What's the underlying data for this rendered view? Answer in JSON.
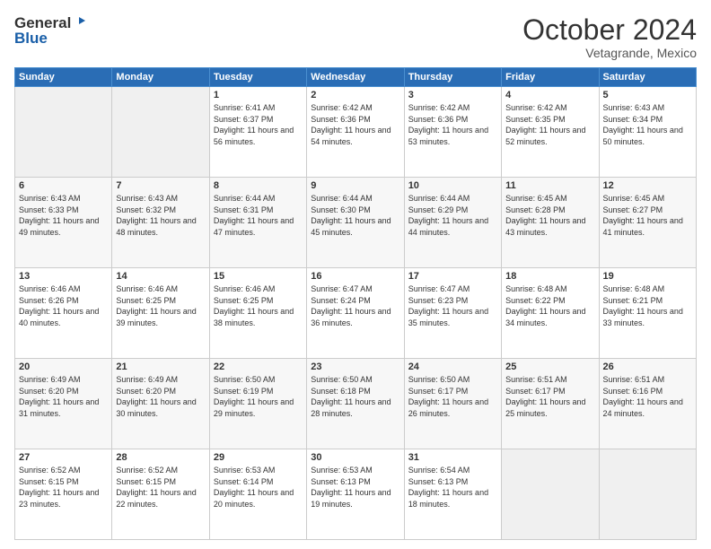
{
  "header": {
    "logo_general": "General",
    "logo_blue": "Blue",
    "month": "October 2024",
    "location": "Vetagrande, Mexico"
  },
  "days_of_week": [
    "Sunday",
    "Monday",
    "Tuesday",
    "Wednesday",
    "Thursday",
    "Friday",
    "Saturday"
  ],
  "weeks": [
    [
      {
        "day": "",
        "sunrise": "",
        "sunset": "",
        "daylight": "",
        "empty": true
      },
      {
        "day": "",
        "sunrise": "",
        "sunset": "",
        "daylight": "",
        "empty": true
      },
      {
        "day": "1",
        "sunrise": "Sunrise: 6:41 AM",
        "sunset": "Sunset: 6:37 PM",
        "daylight": "Daylight: 11 hours and 56 minutes."
      },
      {
        "day": "2",
        "sunrise": "Sunrise: 6:42 AM",
        "sunset": "Sunset: 6:36 PM",
        "daylight": "Daylight: 11 hours and 54 minutes."
      },
      {
        "day": "3",
        "sunrise": "Sunrise: 6:42 AM",
        "sunset": "Sunset: 6:36 PM",
        "daylight": "Daylight: 11 hours and 53 minutes."
      },
      {
        "day": "4",
        "sunrise": "Sunrise: 6:42 AM",
        "sunset": "Sunset: 6:35 PM",
        "daylight": "Daylight: 11 hours and 52 minutes."
      },
      {
        "day": "5",
        "sunrise": "Sunrise: 6:43 AM",
        "sunset": "Sunset: 6:34 PM",
        "daylight": "Daylight: 11 hours and 50 minutes."
      }
    ],
    [
      {
        "day": "6",
        "sunrise": "Sunrise: 6:43 AM",
        "sunset": "Sunset: 6:33 PM",
        "daylight": "Daylight: 11 hours and 49 minutes."
      },
      {
        "day": "7",
        "sunrise": "Sunrise: 6:43 AM",
        "sunset": "Sunset: 6:32 PM",
        "daylight": "Daylight: 11 hours and 48 minutes."
      },
      {
        "day": "8",
        "sunrise": "Sunrise: 6:44 AM",
        "sunset": "Sunset: 6:31 PM",
        "daylight": "Daylight: 11 hours and 47 minutes."
      },
      {
        "day": "9",
        "sunrise": "Sunrise: 6:44 AM",
        "sunset": "Sunset: 6:30 PM",
        "daylight": "Daylight: 11 hours and 45 minutes."
      },
      {
        "day": "10",
        "sunrise": "Sunrise: 6:44 AM",
        "sunset": "Sunset: 6:29 PM",
        "daylight": "Daylight: 11 hours and 44 minutes."
      },
      {
        "day": "11",
        "sunrise": "Sunrise: 6:45 AM",
        "sunset": "Sunset: 6:28 PM",
        "daylight": "Daylight: 11 hours and 43 minutes."
      },
      {
        "day": "12",
        "sunrise": "Sunrise: 6:45 AM",
        "sunset": "Sunset: 6:27 PM",
        "daylight": "Daylight: 11 hours and 41 minutes."
      }
    ],
    [
      {
        "day": "13",
        "sunrise": "Sunrise: 6:46 AM",
        "sunset": "Sunset: 6:26 PM",
        "daylight": "Daylight: 11 hours and 40 minutes."
      },
      {
        "day": "14",
        "sunrise": "Sunrise: 6:46 AM",
        "sunset": "Sunset: 6:25 PM",
        "daylight": "Daylight: 11 hours and 39 minutes."
      },
      {
        "day": "15",
        "sunrise": "Sunrise: 6:46 AM",
        "sunset": "Sunset: 6:25 PM",
        "daylight": "Daylight: 11 hours and 38 minutes."
      },
      {
        "day": "16",
        "sunrise": "Sunrise: 6:47 AM",
        "sunset": "Sunset: 6:24 PM",
        "daylight": "Daylight: 11 hours and 36 minutes."
      },
      {
        "day": "17",
        "sunrise": "Sunrise: 6:47 AM",
        "sunset": "Sunset: 6:23 PM",
        "daylight": "Daylight: 11 hours and 35 minutes."
      },
      {
        "day": "18",
        "sunrise": "Sunrise: 6:48 AM",
        "sunset": "Sunset: 6:22 PM",
        "daylight": "Daylight: 11 hours and 34 minutes."
      },
      {
        "day": "19",
        "sunrise": "Sunrise: 6:48 AM",
        "sunset": "Sunset: 6:21 PM",
        "daylight": "Daylight: 11 hours and 33 minutes."
      }
    ],
    [
      {
        "day": "20",
        "sunrise": "Sunrise: 6:49 AM",
        "sunset": "Sunset: 6:20 PM",
        "daylight": "Daylight: 11 hours and 31 minutes."
      },
      {
        "day": "21",
        "sunrise": "Sunrise: 6:49 AM",
        "sunset": "Sunset: 6:20 PM",
        "daylight": "Daylight: 11 hours and 30 minutes."
      },
      {
        "day": "22",
        "sunrise": "Sunrise: 6:50 AM",
        "sunset": "Sunset: 6:19 PM",
        "daylight": "Daylight: 11 hours and 29 minutes."
      },
      {
        "day": "23",
        "sunrise": "Sunrise: 6:50 AM",
        "sunset": "Sunset: 6:18 PM",
        "daylight": "Daylight: 11 hours and 28 minutes."
      },
      {
        "day": "24",
        "sunrise": "Sunrise: 6:50 AM",
        "sunset": "Sunset: 6:17 PM",
        "daylight": "Daylight: 11 hours and 26 minutes."
      },
      {
        "day": "25",
        "sunrise": "Sunrise: 6:51 AM",
        "sunset": "Sunset: 6:17 PM",
        "daylight": "Daylight: 11 hours and 25 minutes."
      },
      {
        "day": "26",
        "sunrise": "Sunrise: 6:51 AM",
        "sunset": "Sunset: 6:16 PM",
        "daylight": "Daylight: 11 hours and 24 minutes."
      }
    ],
    [
      {
        "day": "27",
        "sunrise": "Sunrise: 6:52 AM",
        "sunset": "Sunset: 6:15 PM",
        "daylight": "Daylight: 11 hours and 23 minutes."
      },
      {
        "day": "28",
        "sunrise": "Sunrise: 6:52 AM",
        "sunset": "Sunset: 6:15 PM",
        "daylight": "Daylight: 11 hours and 22 minutes."
      },
      {
        "day": "29",
        "sunrise": "Sunrise: 6:53 AM",
        "sunset": "Sunset: 6:14 PM",
        "daylight": "Daylight: 11 hours and 20 minutes."
      },
      {
        "day": "30",
        "sunrise": "Sunrise: 6:53 AM",
        "sunset": "Sunset: 6:13 PM",
        "daylight": "Daylight: 11 hours and 19 minutes."
      },
      {
        "day": "31",
        "sunrise": "Sunrise: 6:54 AM",
        "sunset": "Sunset: 6:13 PM",
        "daylight": "Daylight: 11 hours and 18 minutes."
      },
      {
        "day": "",
        "sunrise": "",
        "sunset": "",
        "daylight": "",
        "empty": true
      },
      {
        "day": "",
        "sunrise": "",
        "sunset": "",
        "daylight": "",
        "empty": true
      }
    ]
  ]
}
